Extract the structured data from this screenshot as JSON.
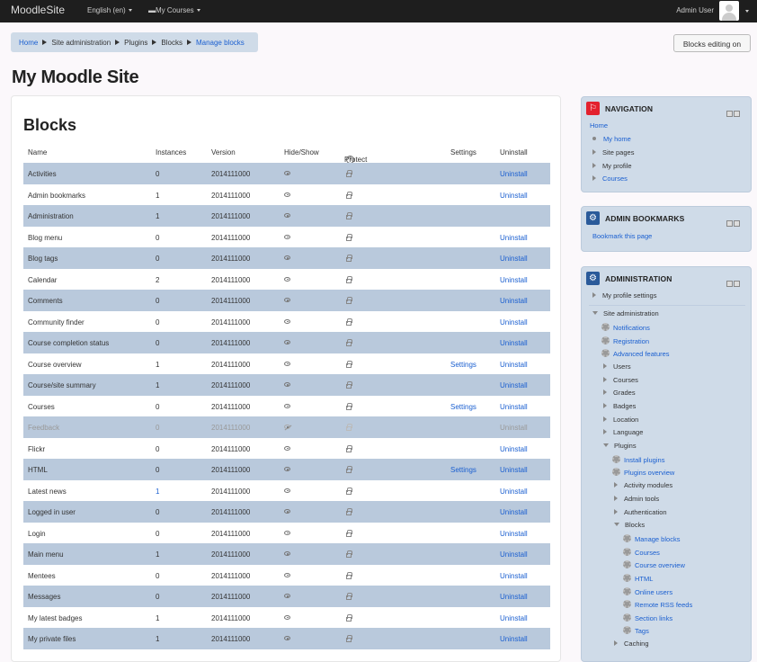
{
  "navbar": {
    "brand": "MoodleSite",
    "language": "English (en)",
    "my_courses": "My Courses",
    "user": "Admin User"
  },
  "breadcrumb": [
    "Home",
    "Site administration",
    "Plugins",
    "Blocks",
    "Manage blocks"
  ],
  "edit_button": "Blocks editing on",
  "page_title": "My Moodle Site",
  "blocks_title": "Blocks",
  "columns": {
    "name": "Name",
    "instances": "Instances",
    "version": "Version",
    "hideshow": "Hide/Show",
    "protect": "Protect instances",
    "settings": "Settings",
    "uninstall": "Uninstall"
  },
  "rows": [
    {
      "name": "Activities",
      "instances": "0",
      "version": "2014111000",
      "settings": "",
      "uninstall": "Uninstall"
    },
    {
      "name": "Admin bookmarks",
      "instances": "1",
      "version": "2014111000",
      "settings": "",
      "uninstall": "Uninstall"
    },
    {
      "name": "Administration",
      "instances": "1",
      "version": "2014111000",
      "settings": "",
      "uninstall": ""
    },
    {
      "name": "Blog menu",
      "instances": "0",
      "version": "2014111000",
      "settings": "",
      "uninstall": "Uninstall"
    },
    {
      "name": "Blog tags",
      "instances": "0",
      "version": "2014111000",
      "settings": "",
      "uninstall": "Uninstall"
    },
    {
      "name": "Calendar",
      "instances": "2",
      "version": "2014111000",
      "settings": "",
      "uninstall": "Uninstall"
    },
    {
      "name": "Comments",
      "instances": "0",
      "version": "2014111000",
      "settings": "",
      "uninstall": "Uninstall"
    },
    {
      "name": "Community finder",
      "instances": "0",
      "version": "2014111000",
      "settings": "",
      "uninstall": "Uninstall"
    },
    {
      "name": "Course completion status",
      "instances": "0",
      "version": "2014111000",
      "settings": "",
      "uninstall": "Uninstall"
    },
    {
      "name": "Course overview",
      "instances": "1",
      "version": "2014111000",
      "settings": "Settings",
      "uninstall": "Uninstall"
    },
    {
      "name": "Course/site summary",
      "instances": "1",
      "version": "2014111000",
      "settings": "",
      "uninstall": "Uninstall"
    },
    {
      "name": "Courses",
      "instances": "0",
      "version": "2014111000",
      "settings": "Settings",
      "uninstall": "Uninstall"
    },
    {
      "name": "Feedback",
      "instances": "0",
      "version": "2014111000",
      "settings": "",
      "uninstall": "Uninstall"
    },
    {
      "name": "Flickr",
      "instances": "0",
      "version": "2014111000",
      "settings": "",
      "uninstall": "Uninstall"
    },
    {
      "name": "HTML",
      "instances": "0",
      "version": "2014111000",
      "settings": "Settings",
      "uninstall": "Uninstall"
    },
    {
      "name": "Latest news",
      "instances": "1",
      "version": "2014111000",
      "settings": "",
      "uninstall": "Uninstall"
    },
    {
      "name": "Logged in user",
      "instances": "0",
      "version": "2014111000",
      "settings": "",
      "uninstall": "Uninstall"
    },
    {
      "name": "Login",
      "instances": "0",
      "version": "2014111000",
      "settings": "",
      "uninstall": "Uninstall"
    },
    {
      "name": "Main menu",
      "instances": "1",
      "version": "2014111000",
      "settings": "",
      "uninstall": "Uninstall"
    },
    {
      "name": "Mentees",
      "instances": "0",
      "version": "2014111000",
      "settings": "",
      "uninstall": "Uninstall"
    },
    {
      "name": "Messages",
      "instances": "0",
      "version": "2014111000",
      "settings": "",
      "uninstall": "Uninstall"
    },
    {
      "name": "My latest badges",
      "instances": "1",
      "version": "2014111000",
      "settings": "",
      "uninstall": "Uninstall"
    },
    {
      "name": "My private files",
      "instances": "1",
      "version": "2014111000",
      "settings": "",
      "uninstall": "Uninstall"
    }
  ],
  "navigation": {
    "title": "NAVIGATION",
    "home": "Home",
    "items": [
      "My home",
      "Site pages",
      "My profile",
      "Courses"
    ]
  },
  "bookmarks": {
    "title": "ADMIN BOOKMARKS",
    "link": "Bookmark this page"
  },
  "administration": {
    "title": "ADMINISTRATION",
    "items": [
      "My profile settings",
      "Site administration",
      "Notifications",
      "Registration",
      "Advanced features",
      "Users",
      "Courses",
      "Grades",
      "Badges",
      "Location",
      "Language",
      "Plugins",
      "Install plugins",
      "Plugins overview",
      "Activity modules",
      "Admin tools",
      "Authentication",
      "Blocks",
      "Manage blocks",
      "Courses",
      "Course overview",
      "HTML",
      "Online users",
      "Remote RSS feeds",
      "Section links",
      "Tags",
      "Caching"
    ]
  },
  "colors": {
    "navbar": "#1e1e1e",
    "row_alt": "#b9c9dc",
    "link": "#1a5fd0",
    "block_bg": "#cfdbe8",
    "nav_icon": "#e3212e",
    "admin_icon": "#2a5a9a"
  }
}
